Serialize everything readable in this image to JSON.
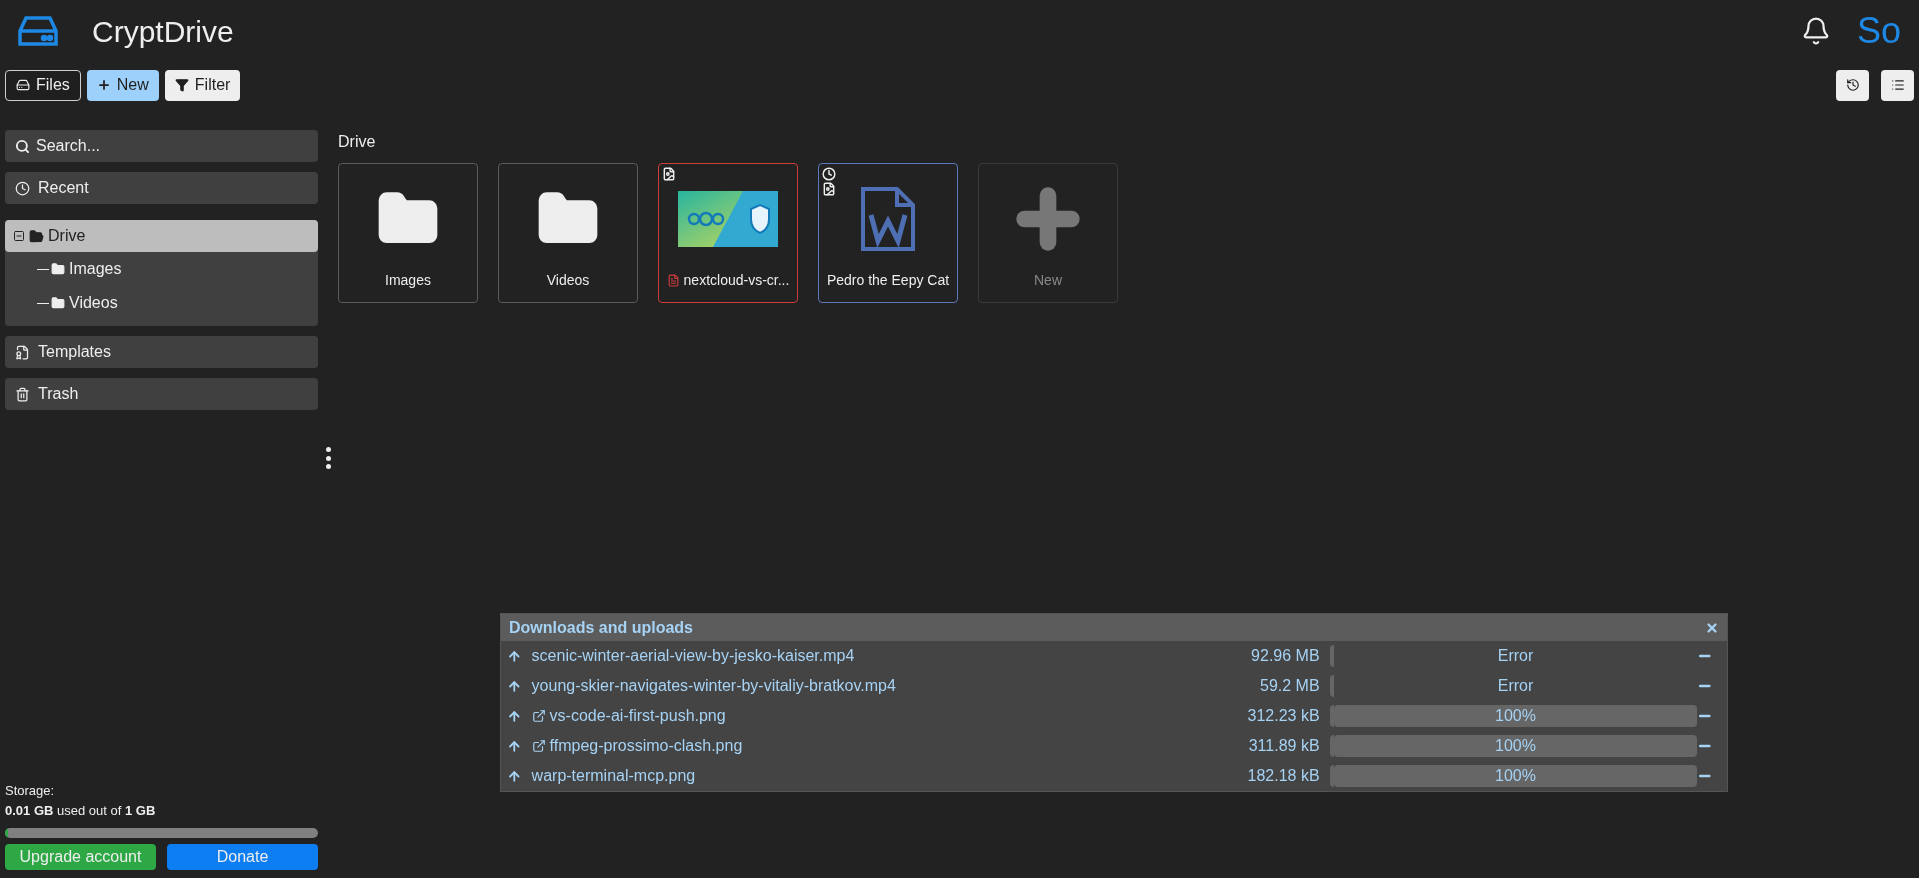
{
  "app": {
    "title": "CryptDrive",
    "user_initials": "So"
  },
  "toolbar": {
    "buttons": [
      {
        "kind": "files",
        "label": "Files"
      },
      {
        "kind": "new",
        "label": "New"
      },
      {
        "kind": "filter",
        "label": "Filter"
      }
    ]
  },
  "sidebar": {
    "search": {
      "placeholder": "Search..."
    },
    "items": [
      {
        "kind": "recent",
        "label": "Recent",
        "selected": false
      },
      {
        "kind": "drive",
        "label": "Drive",
        "selected": true,
        "expanded": true,
        "children": [
          {
            "label": "Images",
            "selected": false
          },
          {
            "label": "Videos",
            "selected": false
          }
        ]
      },
      {
        "kind": "templates",
        "label": "Templates",
        "selected": false
      },
      {
        "kind": "trash",
        "label": "Trash",
        "selected": false
      }
    ],
    "storage": {
      "label": "Storage:",
      "usage": "**0.01 GB** used out of **1 GB**",
      "level": 0.01
    },
    "buttons": [
      {
        "kind": "upgrade",
        "label": "Upgrade account"
      },
      {
        "kind": "donate",
        "label": "Donate"
      }
    ]
  },
  "breadcrumb": "Drive",
  "tiles": [
    {
      "kind": "folder",
      "label": "Images",
      "color": "#5a5a5a",
      "shared": false,
      "recent": false
    },
    {
      "kind": "folder",
      "label": "Videos",
      "color": "#5a5a5a",
      "shared": false,
      "recent": false
    },
    {
      "kind": "image",
      "label": "nextcloud-vs-cr...",
      "color": "#d13d3d",
      "shared": true,
      "recent": false
    },
    {
      "kind": "document",
      "label": "Pedro the Eepy Cat",
      "color": "#5c7ab8",
      "shared": true,
      "recent": true
    },
    {
      "kind": "new",
      "label": "New",
      "color": "#3a3a3a",
      "shared": false,
      "recent": false
    }
  ],
  "transfers": {
    "title": "Downloads and uploads",
    "rows": [
      {
        "name": "scenic-winter-aerial-view-by-jesko-kaiser.mp4",
        "link": false,
        "size": "92.96 MB",
        "status": "Error",
        "level": 0
      },
      {
        "name": "young-skier-navigates-winter-by-vitaliy-bratkov.mp4",
        "link": false,
        "size": "59.2 MB",
        "status": "Error",
        "level": 0
      },
      {
        "name": "vs-code-ai-first-push.png",
        "link": true,
        "size": "312.23 kB",
        "status": "100%",
        "level": 1
      },
      {
        "name": "ffmpeg-prossimo-clash.png",
        "link": true,
        "size": "311.89 kB",
        "status": "100%",
        "level": 1
      },
      {
        "name": "warp-terminal-mcp.png",
        "link": false,
        "size": "182.18 kB",
        "status": "100%",
        "level": 1
      }
    ]
  }
}
